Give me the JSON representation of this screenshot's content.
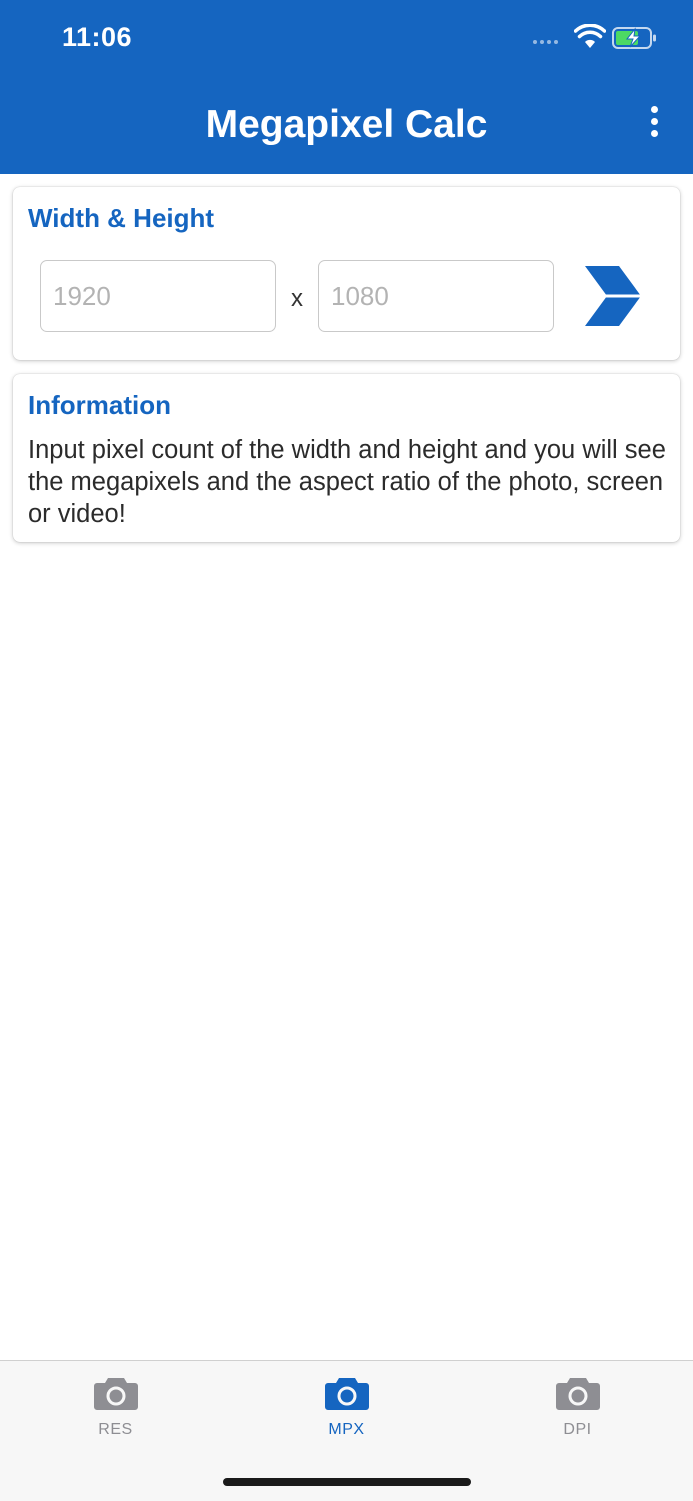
{
  "status_bar": {
    "time": "11:06"
  },
  "app_bar": {
    "title": "Megapixel Calc",
    "menu_icon": "more-vert-icon"
  },
  "dimensions_card": {
    "title": "Width & Height",
    "width_input": {
      "value": "",
      "placeholder": "1920"
    },
    "separator": "x",
    "height_input": {
      "value": "",
      "placeholder": "1080"
    },
    "submit_icon": "chevron-right-icon"
  },
  "info_card": {
    "title": "Information",
    "body": "Input pixel count of the width and height and you will see the megapixels and the aspect ratio of the photo, screen or video!"
  },
  "tabs": [
    {
      "label": "RES",
      "icon": "camera-icon",
      "active": false
    },
    {
      "label": "MPX",
      "icon": "camera-icon",
      "active": true
    },
    {
      "label": "DPI",
      "icon": "camera-icon",
      "active": false
    }
  ],
  "colors": {
    "primary": "#1565c0",
    "inactive_tab": "#8e8e93",
    "background": "#ffffff"
  }
}
